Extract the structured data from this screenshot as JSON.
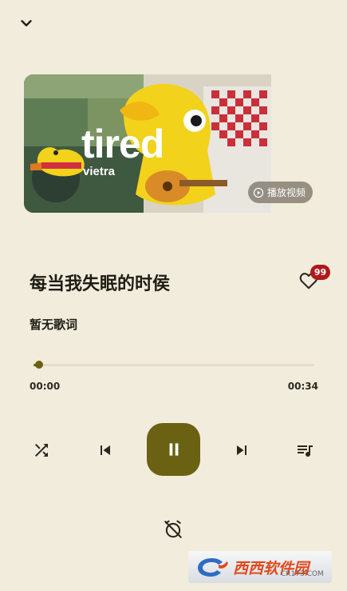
{
  "cover": {
    "title": "tired",
    "artist": "vietra",
    "video_label": "播放视频"
  },
  "song": {
    "title": "每当我失眠的时侯",
    "like_count": "99",
    "lyrics": "暂无歌词"
  },
  "progress": {
    "current": "00:00",
    "total": "00:34",
    "fraction": 0.02
  },
  "icons": {
    "collapse": "chevron-down-icon",
    "video": "play-circle-icon",
    "like": "heart-outline-icon",
    "shuffle": "shuffle-icon",
    "previous": "skip-previous-icon",
    "play_pause": "pause-icon",
    "next": "skip-next-icon",
    "playlist": "queue-music-icon",
    "timer": "alarm-off-icon"
  },
  "colors": {
    "background": "#f2ecdc",
    "accent": "#6b6112",
    "badge": "#b0191b"
  },
  "watermark": {
    "text": "西西软件园",
    "domain": "CR173.COM"
  }
}
